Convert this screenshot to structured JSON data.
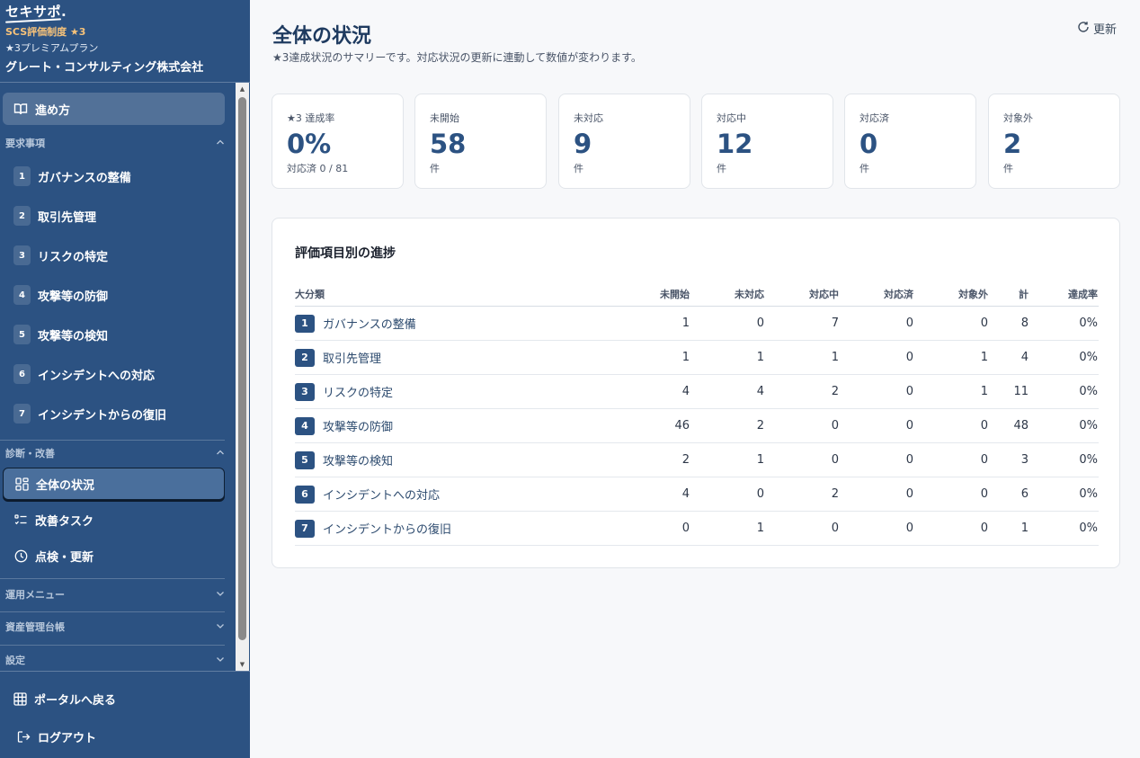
{
  "sidebar": {
    "logo": "セキサポ.",
    "program": "SCS評価制度 ★3",
    "plan": "★3プレミアムプラン",
    "company": "グレート・コンサルティング株式会社",
    "guide": "進め方",
    "requirements_header": "要求事項",
    "requirements": [
      {
        "num": "1",
        "label": "ガバナンスの整備"
      },
      {
        "num": "2",
        "label": "取引先管理"
      },
      {
        "num": "3",
        "label": "リスクの特定"
      },
      {
        "num": "4",
        "label": "攻撃等の防御"
      },
      {
        "num": "5",
        "label": "攻撃等の検知"
      },
      {
        "num": "6",
        "label": "インシデントへの対応"
      },
      {
        "num": "7",
        "label": "インシデントからの復旧"
      }
    ],
    "diagnosis_header": "診断・改善",
    "overview": "全体の状況",
    "tasks": "改善タスク",
    "review": "点検・更新",
    "ops_header": "運用メニュー",
    "assets_header": "資産管理台帳",
    "settings_header": "設定",
    "portal": "ポータルへ戻る",
    "logout": "ログアウト"
  },
  "header": {
    "title": "全体の状況",
    "subtitle": "★3達成状況のサマリーです。対応状況の更新に連動して数値が変わります。",
    "refresh": "更新"
  },
  "cards": [
    {
      "label": "★3 達成率",
      "value": "0%",
      "unit": "対応済 0 / 81"
    },
    {
      "label": "未開始",
      "value": "58",
      "unit": "件"
    },
    {
      "label": "未対応",
      "value": "9",
      "unit": "件"
    },
    {
      "label": "対応中",
      "value": "12",
      "unit": "件"
    },
    {
      "label": "対応済",
      "value": "0",
      "unit": "件"
    },
    {
      "label": "対象外",
      "value": "2",
      "unit": "件"
    }
  ],
  "progress": {
    "title": "評価項目別の進捗",
    "columns": [
      "大分類",
      "未開始",
      "未対応",
      "対応中",
      "対応済",
      "対象外",
      "計",
      "達成率"
    ],
    "rows": [
      {
        "num": "1",
        "name": "ガバナンスの整備",
        "not_started": "1",
        "unhandled": "0",
        "in_progress": "7",
        "done": "0",
        "excluded": "0",
        "total": "8",
        "rate": "0%"
      },
      {
        "num": "2",
        "name": "取引先管理",
        "not_started": "1",
        "unhandled": "1",
        "in_progress": "1",
        "done": "0",
        "excluded": "1",
        "total": "4",
        "rate": "0%"
      },
      {
        "num": "3",
        "name": "リスクの特定",
        "not_started": "4",
        "unhandled": "4",
        "in_progress": "2",
        "done": "0",
        "excluded": "1",
        "total": "11",
        "rate": "0%"
      },
      {
        "num": "4",
        "name": "攻撃等の防御",
        "not_started": "46",
        "unhandled": "2",
        "in_progress": "0",
        "done": "0",
        "excluded": "0",
        "total": "48",
        "rate": "0%"
      },
      {
        "num": "5",
        "name": "攻撃等の検知",
        "not_started": "2",
        "unhandled": "1",
        "in_progress": "0",
        "done": "0",
        "excluded": "0",
        "total": "3",
        "rate": "0%"
      },
      {
        "num": "6",
        "name": "インシデントへの対応",
        "not_started": "4",
        "unhandled": "0",
        "in_progress": "2",
        "done": "0",
        "excluded": "0",
        "total": "6",
        "rate": "0%"
      },
      {
        "num": "7",
        "name": "インシデントからの復旧",
        "not_started": "0",
        "unhandled": "1",
        "in_progress": "0",
        "done": "0",
        "excluded": "0",
        "total": "1",
        "rate": "0%"
      }
    ]
  }
}
